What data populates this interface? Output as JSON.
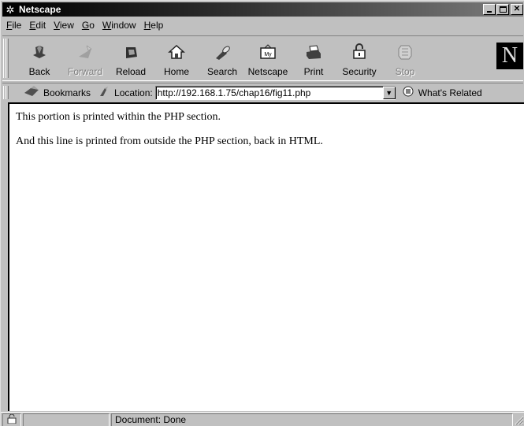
{
  "window": {
    "title": "Netscape",
    "app_icon": "netscape-wheel-icon"
  },
  "menu": [
    {
      "label": "File",
      "key": "F"
    },
    {
      "label": "Edit",
      "key": "E"
    },
    {
      "label": "View",
      "key": "V"
    },
    {
      "label": "Go",
      "key": "G"
    },
    {
      "label": "Window",
      "key": "W"
    },
    {
      "label": "Help",
      "key": "H"
    }
  ],
  "toolbar": {
    "back": "Back",
    "forward": "Forward",
    "reload": "Reload",
    "home": "Home",
    "search": "Search",
    "netscape": "Netscape",
    "print": "Print",
    "security": "Security",
    "stop": "Stop",
    "logo_letter": "N"
  },
  "location_bar": {
    "bookmarks": "Bookmarks",
    "location_label": "Location:",
    "url": "http://192.168.1.75/chap16/fig11.php",
    "whats_related": "What's Related"
  },
  "content": {
    "line1": "This portion is printed within the PHP section.",
    "line2": "And this line is printed from outside the PHP section, back in HTML."
  },
  "status": {
    "text": "Document: Done"
  }
}
